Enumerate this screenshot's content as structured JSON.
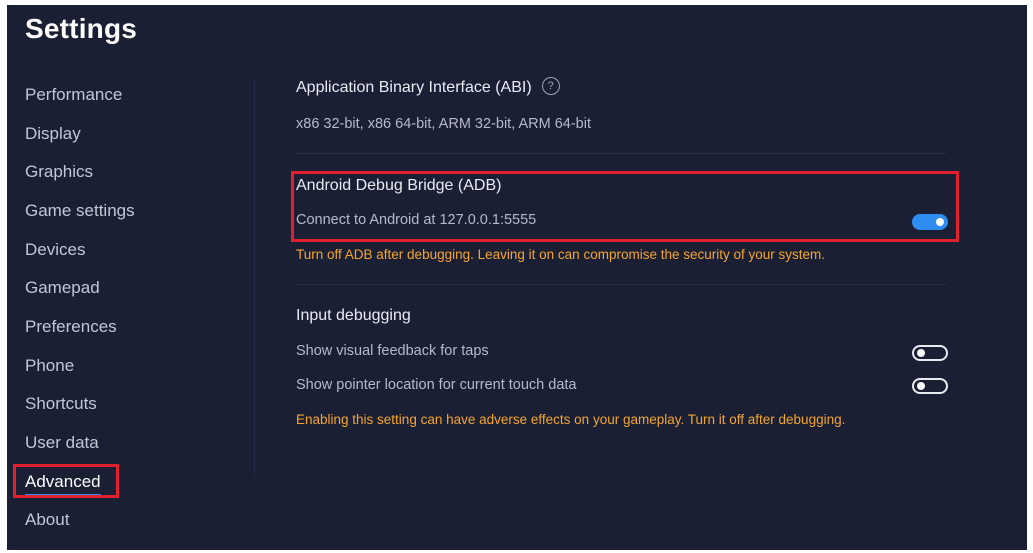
{
  "window": {
    "title": "Settings"
  },
  "sidebar": {
    "items": [
      {
        "label": "Performance"
      },
      {
        "label": "Display"
      },
      {
        "label": "Graphics"
      },
      {
        "label": "Game settings"
      },
      {
        "label": "Devices"
      },
      {
        "label": "Gamepad"
      },
      {
        "label": "Preferences"
      },
      {
        "label": "Phone"
      },
      {
        "label": "Shortcuts"
      },
      {
        "label": "User data"
      },
      {
        "label": "Advanced"
      },
      {
        "label": "About"
      }
    ],
    "active_item": "Advanced"
  },
  "abi": {
    "heading": "Application Binary Interface (ABI)",
    "help_icon": "?",
    "value": "x86 32-bit, x86 64-bit, ARM 32-bit, ARM 64-bit"
  },
  "adb": {
    "heading": "Android Debug Bridge (ADB)",
    "label": "Connect to Android at 127.0.0.1:5555",
    "enabled": true,
    "warning": "Turn off ADB after debugging. Leaving it on can compromise the security of your system."
  },
  "input_debugging": {
    "heading": "Input debugging",
    "options": [
      {
        "label": "Show visual feedback for taps",
        "enabled": false
      },
      {
        "label": "Show pointer location for current touch data",
        "enabled": false
      }
    ],
    "warning": "Enabling this setting can have adverse effects on your gameplay. Turn it off after debugging."
  },
  "colors": {
    "background": "#1b1f34",
    "accent": "#2d8df0",
    "warning": "#f3a52e",
    "highlight": "#e0202e"
  }
}
